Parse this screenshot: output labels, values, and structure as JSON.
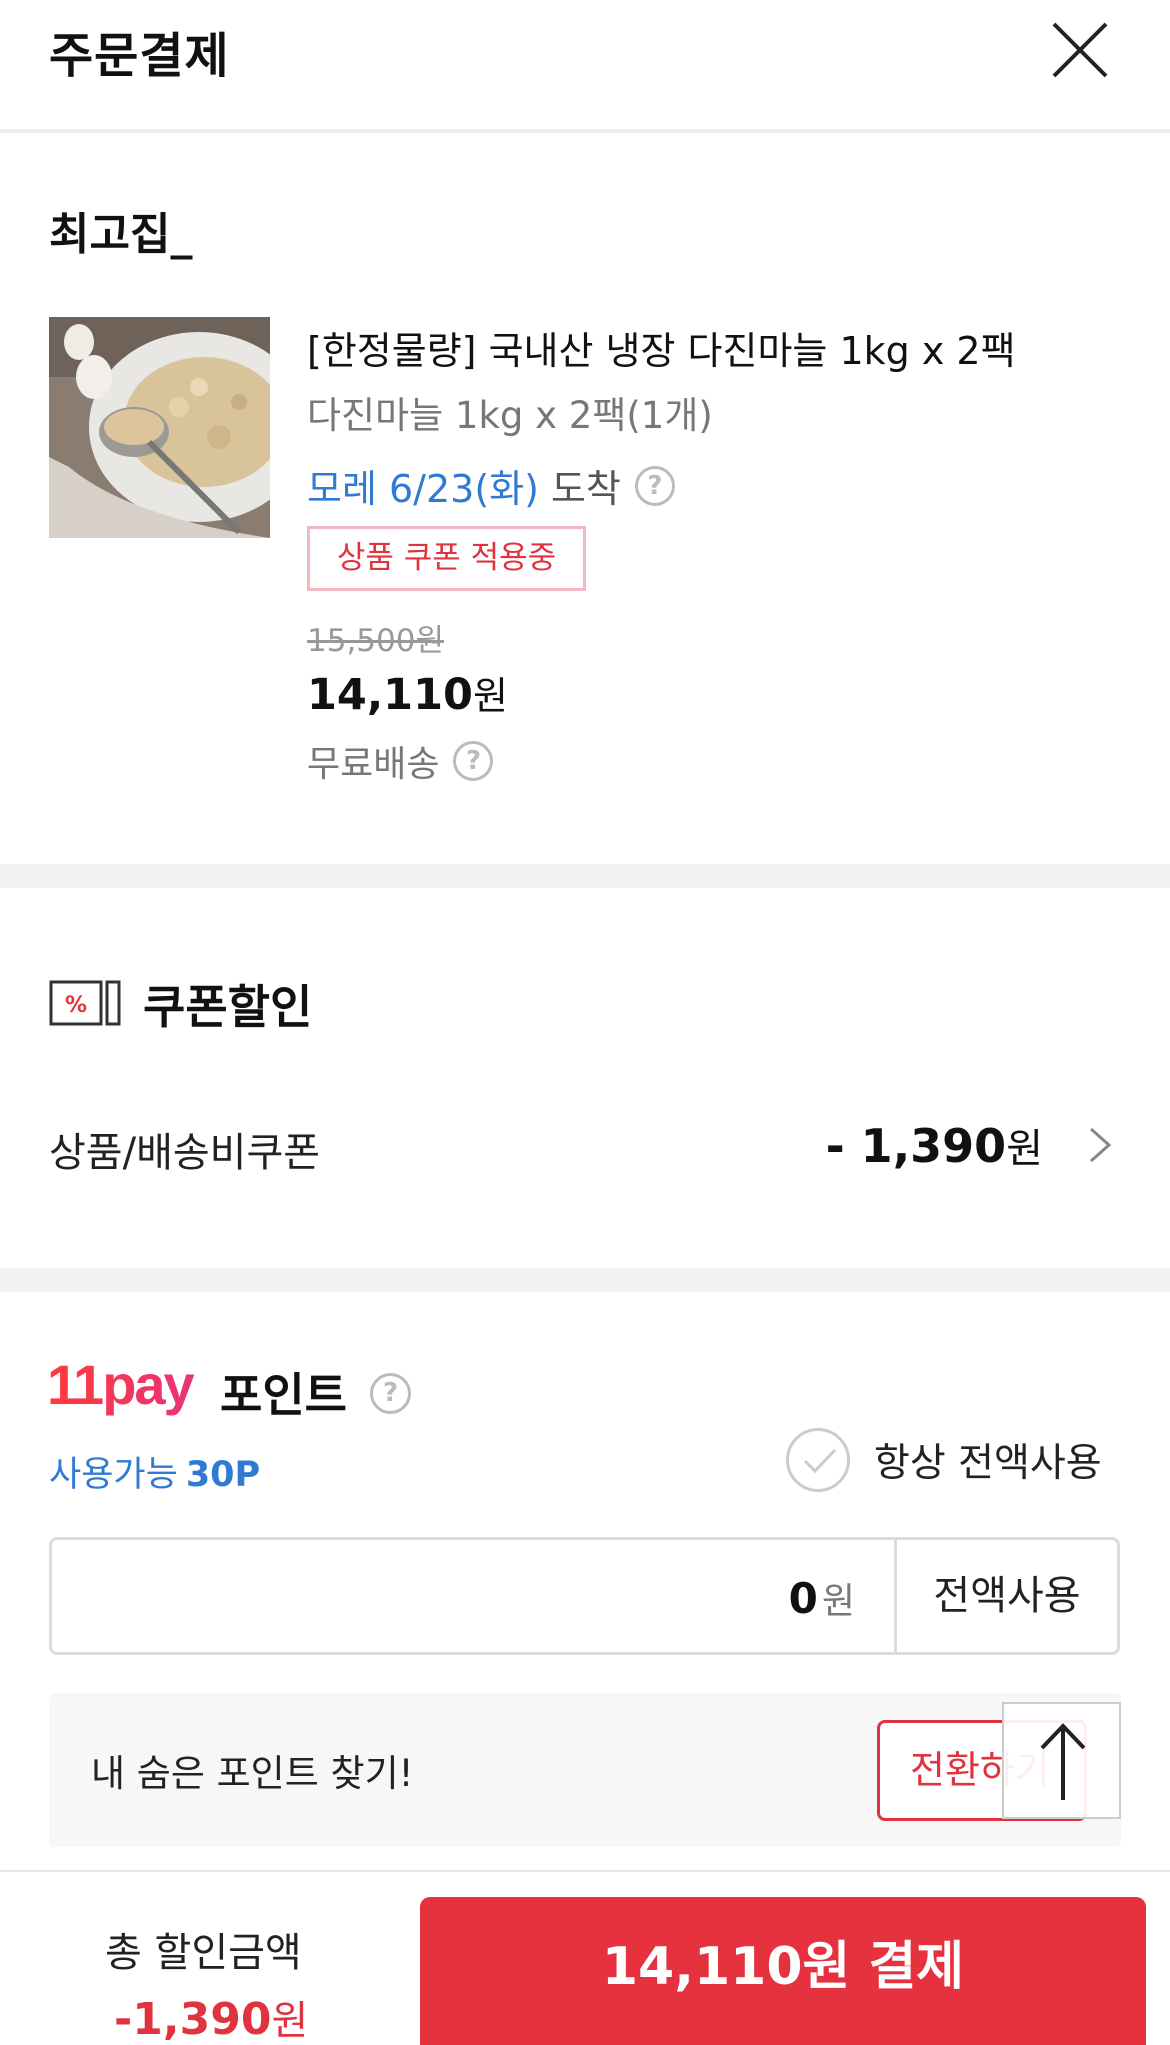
{
  "header": {
    "title": "주문결제",
    "close_icon": "close-icon"
  },
  "seller": {
    "name": "최고집_"
  },
  "product": {
    "image_icon": "garlic-product-image",
    "title": "[한정물량] 국내산 냉장 다진마늘 1kg x 2팩",
    "option": "다진마늘 1kg x 2팩(1개)",
    "arrival_date": "모레 6/23(화)",
    "arrival_word": "도착",
    "coupon_badge": "상품 쿠폰 적용중",
    "original_price": "15,500원",
    "sale_price_number": "14,110",
    "sale_price_unit": "원",
    "shipping": "무료배송",
    "help_mark": "?"
  },
  "coupon": {
    "title": "쿠폰할인",
    "icon_text": "%",
    "row_label": "상품/배송비쿠폰",
    "row_value_number": "- 1,390",
    "row_value_unit": "원"
  },
  "points": {
    "logo_text": "11pay",
    "title": "포인트",
    "available_label": "사용가능",
    "available_value": "30P",
    "always_use_label": "항상 전액사용",
    "always_use_checked": false,
    "input_value": "0",
    "input_unit": "원",
    "full_use_button": "전액사용",
    "hidden_points_text": "내 숨은 포인트 찾기!",
    "convert_button": "전환하기"
  },
  "bottom": {
    "total_discount_label": "총 할인금액",
    "total_discount_number": "-1,390",
    "total_discount_unit": "원",
    "pay_button": "14,110원 결제"
  },
  "colors": {
    "accent_red": "#e6323f",
    "link_blue": "#2f7bd2",
    "gray_text": "#777777"
  }
}
